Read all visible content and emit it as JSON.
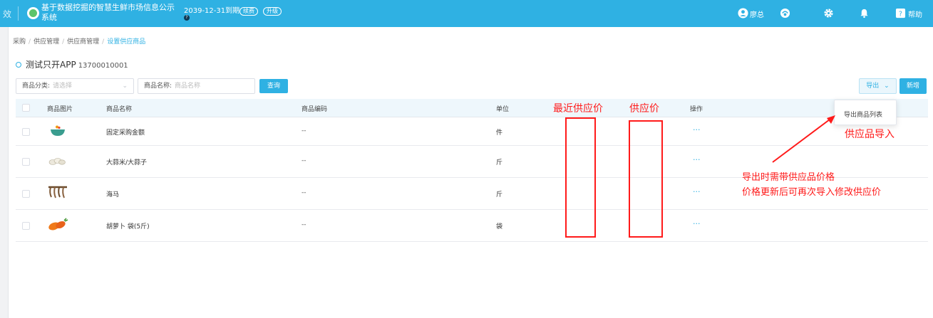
{
  "topbar": {
    "cut_text": "效",
    "system_title": "基于数据挖掘的智慧生鲜市场信息公示系统",
    "expire": "2039-12-31到期",
    "help_mark": "?",
    "badge_renew": "续费",
    "badge_upgrade": "升级",
    "user": "廖总",
    "help": "帮助",
    "bg_color": "#2fb1e3"
  },
  "breadcrumb": [
    "采购",
    "供应管理",
    "供应商管理",
    "设置供应商品"
  ],
  "breadcrumb_sep": "/",
  "supplier": {
    "name": "测试只开APP",
    "phone": "13700010001"
  },
  "filters": {
    "category_label": "商品分类:",
    "category_placeholder": "请选择",
    "name_label": "商品名称:",
    "name_placeholder": "商品名称",
    "query_button": "查询"
  },
  "actions": {
    "export": "导出",
    "add": "新增"
  },
  "export_menu": {
    "items": [
      "导出商品列表"
    ]
  },
  "table": {
    "headers": [
      "商品图片",
      "商品名称",
      "商品编码",
      "单位",
      "操作"
    ],
    "rows": [
      {
        "name": "固定采购金额",
        "code": "--",
        "unit": "件",
        "op": "···",
        "thumb": "bowl-icon"
      },
      {
        "name": "大蒜米/大蒜子",
        "code": "--",
        "unit": "斤",
        "op": "···",
        "thumb": "garlic-icon"
      },
      {
        "name": "海马",
        "code": "--",
        "unit": "斤",
        "op": "···",
        "thumb": "seahorse-icon"
      },
      {
        "name": "胡萝卜 袋(5斤)",
        "code": "--",
        "unit": "袋",
        "op": "···",
        "thumb": "carrot-icon"
      }
    ]
  },
  "annotations": {
    "recent_price": "最近供应价",
    "supply_price": "供应价",
    "import": "供应品导入",
    "note_line1": "导出时需带供应品价格",
    "note_line2": "价格更新后可再次导入修改供应价",
    "color": "#ff1a1a"
  }
}
